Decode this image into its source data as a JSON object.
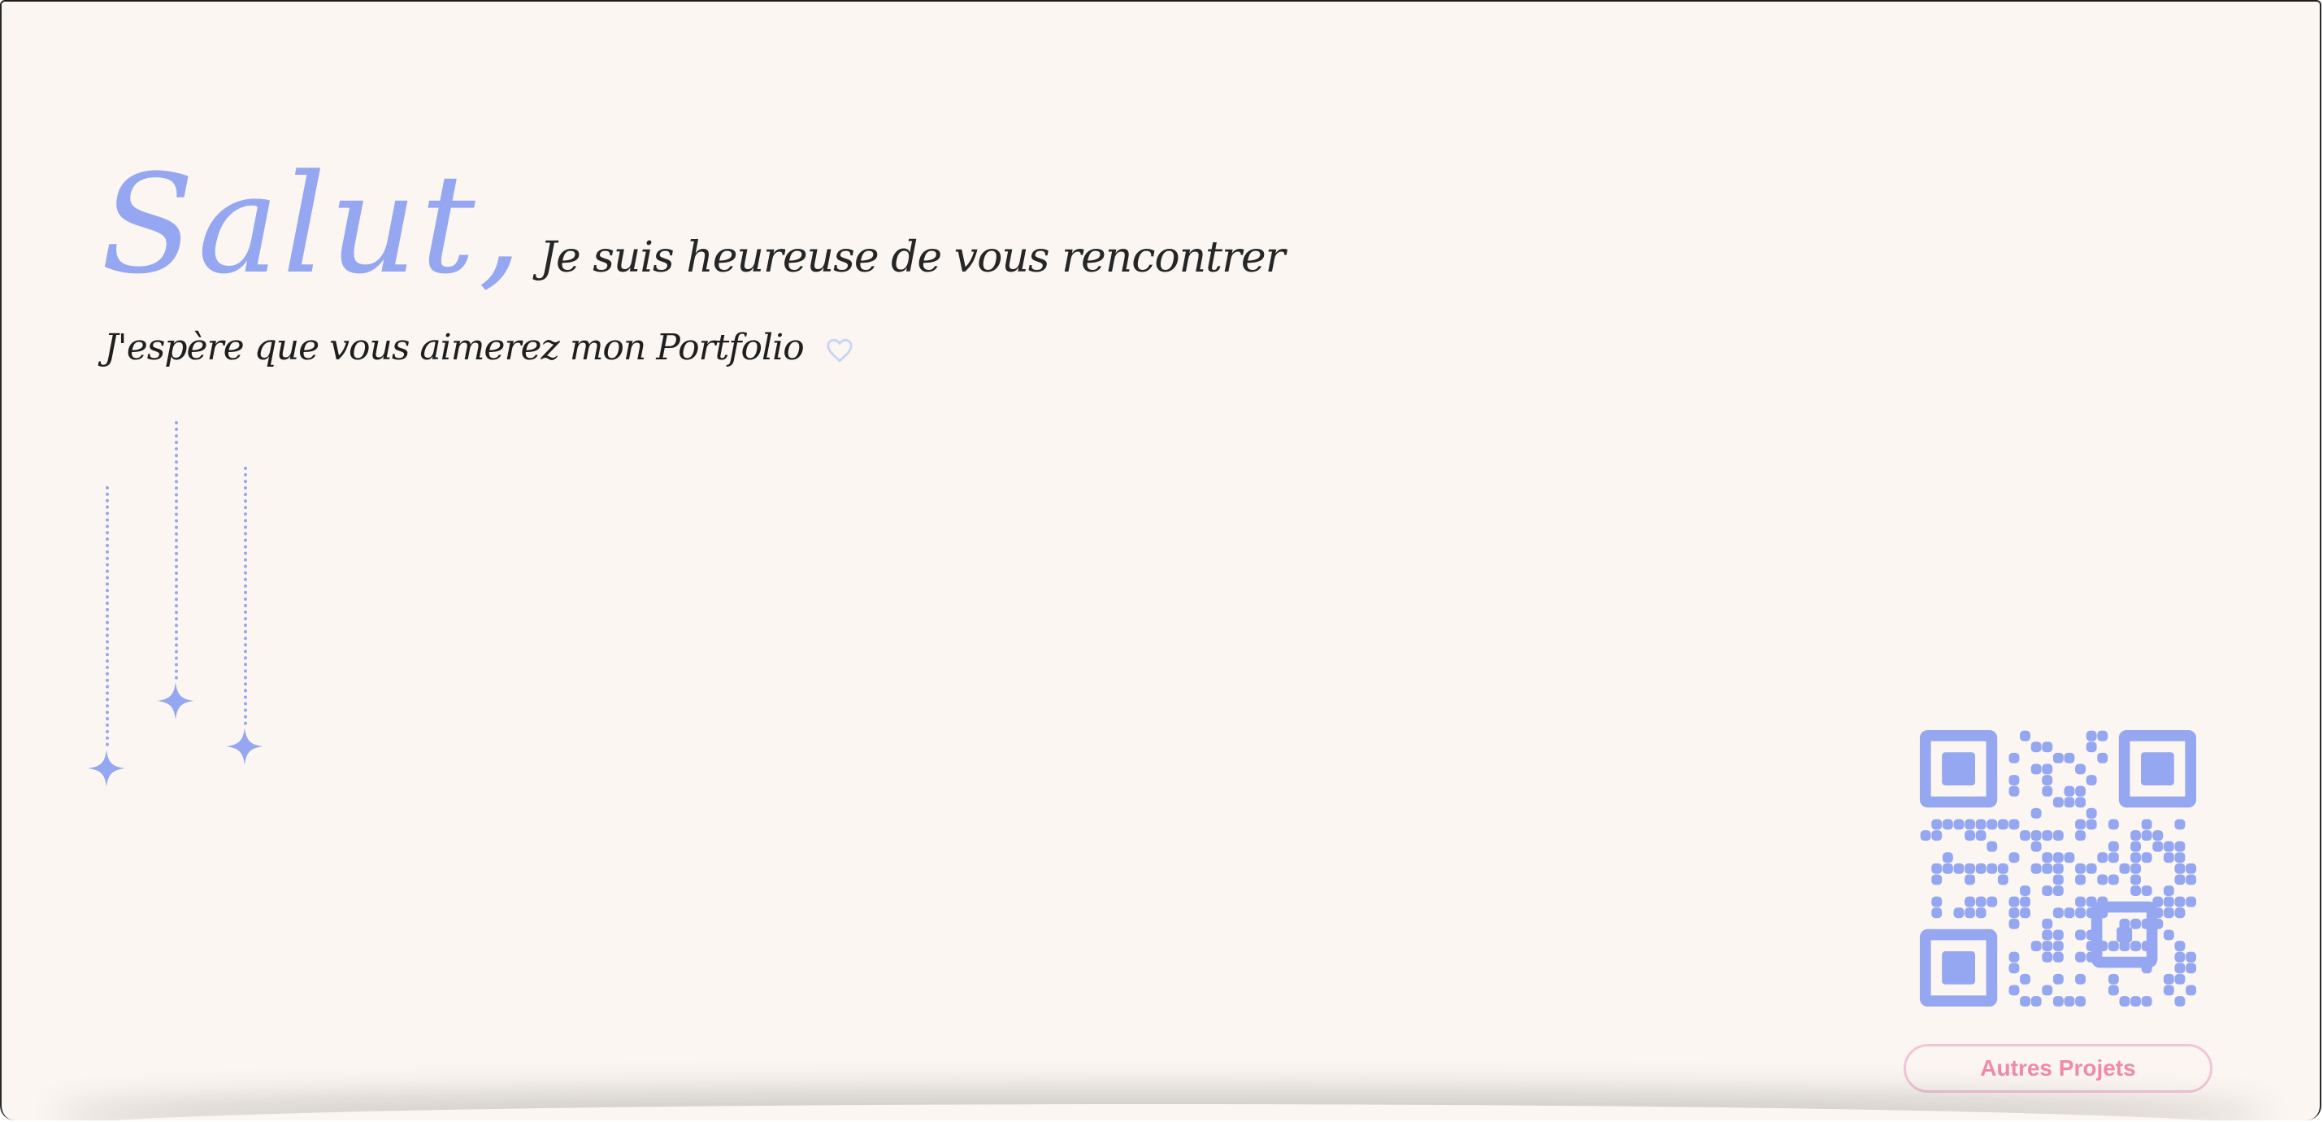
{
  "hero": {
    "salut": "Salut,",
    "headline": "Je suis heureuse de vous rencontrer",
    "subline": "J'espère que vous aimerez mon Portfolio"
  },
  "icons": {
    "heart": "heart-icon",
    "star": "sparkle-star-icon",
    "qr": "qr-code"
  },
  "cta": {
    "projects_label": "Autres Projets"
  },
  "colors": {
    "accent": "#96a7f1",
    "background": "#fbf6f1",
    "button_text": "#f08aad",
    "button_border": "#f3c4d8"
  }
}
